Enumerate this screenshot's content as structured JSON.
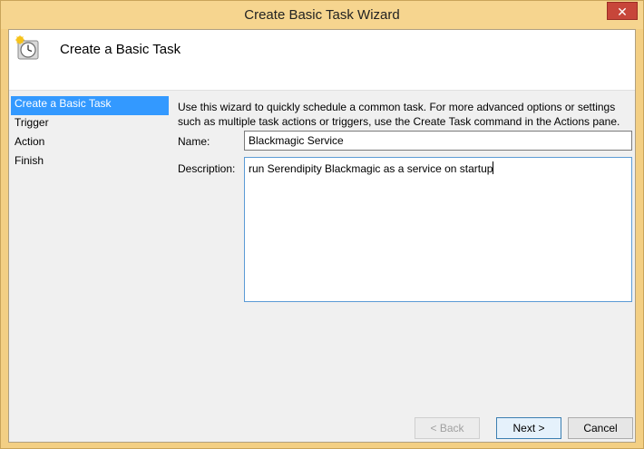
{
  "window": {
    "title": "Create Basic Task Wizard",
    "close_glyph": "✕"
  },
  "header": {
    "title": "Create a Basic Task",
    "icon": "task-scheduler-clock-icon"
  },
  "nav": {
    "items": [
      {
        "label": "Create a Basic Task",
        "active": true
      },
      {
        "label": "Trigger",
        "active": false
      },
      {
        "label": "Action",
        "active": false
      },
      {
        "label": "Finish",
        "active": false
      }
    ]
  },
  "content": {
    "intro_line1": "Use this wizard to quickly schedule a common task.  For more advanced options or settings",
    "intro_line2": "such as multiple task actions or triggers, use the Create Task command in the Actions pane.",
    "name_label": "Name:",
    "name_value": "Blackmagic Service",
    "description_label": "Description:",
    "description_value": "run Serendipity Blackmagic as a service on startup"
  },
  "buttons": {
    "back": "< Back",
    "next": "Next >",
    "cancel": "Cancel"
  },
  "colors": {
    "accent": "#3399ff",
    "frame": "#f3cf84",
    "close": "#c7463a"
  }
}
